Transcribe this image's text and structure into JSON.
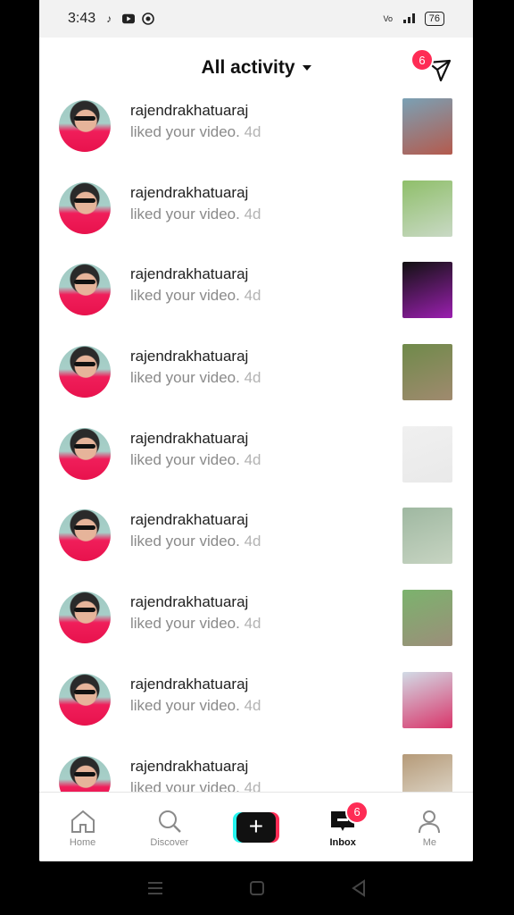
{
  "status_bar": {
    "time": "3:43",
    "battery": "76"
  },
  "header": {
    "title": "All activity",
    "dm_badge": "6"
  },
  "notifications": [
    {
      "username": "rajendrakhatuaraj",
      "message": "liked your video.",
      "time": "4d",
      "thumb_colors": [
        "#7aa1b5",
        "#b45a4d"
      ]
    },
    {
      "username": "rajendrakhatuaraj",
      "message": "liked your video.",
      "time": "4d",
      "thumb_colors": [
        "#8fbf6a",
        "#c9d9c5"
      ]
    },
    {
      "username": "rajendrakhatuaraj",
      "message": "liked your video.",
      "time": "4d",
      "thumb_colors": [
        "#111111",
        "#9b1fb0"
      ]
    },
    {
      "username": "rajendrakhatuaraj",
      "message": "liked your video.",
      "time": "4d",
      "thumb_colors": [
        "#6f8a4a",
        "#a08a6f"
      ]
    },
    {
      "username": "rajendrakhatuaraj",
      "message": "liked your video.",
      "time": "4d",
      "thumb_colors": [
        "#f0f0f0",
        "#e9e9e9"
      ]
    },
    {
      "username": "rajendrakhatuaraj",
      "message": "liked your video.",
      "time": "4d",
      "thumb_colors": [
        "#9fb8a1",
        "#c7d4c2"
      ]
    },
    {
      "username": "rajendrakhatuaraj",
      "message": "liked your video.",
      "time": "4d",
      "thumb_colors": [
        "#7bb36d",
        "#9c8e7a"
      ]
    },
    {
      "username": "rajendrakhatuaraj",
      "message": "liked your video.",
      "time": "4d",
      "thumb_colors": [
        "#d2dbe6",
        "#d9356a"
      ]
    },
    {
      "username": "rajendrakhatuaraj",
      "message": "liked your video.",
      "time": "4d",
      "thumb_colors": [
        "#b59a78",
        "#e6e2d8"
      ]
    }
  ],
  "tabs": [
    {
      "label": "Home",
      "icon": "home-icon",
      "active": false
    },
    {
      "label": "Discover",
      "icon": "search-icon",
      "active": false
    },
    {
      "label": "",
      "icon": "plus-icon",
      "active": false
    },
    {
      "label": "Inbox",
      "icon": "inbox-icon",
      "active": true,
      "badge": "6"
    },
    {
      "label": "Me",
      "icon": "profile-icon",
      "active": false
    }
  ],
  "colors": {
    "accent": "#fe2c55",
    "cyan": "#25f4ee"
  }
}
